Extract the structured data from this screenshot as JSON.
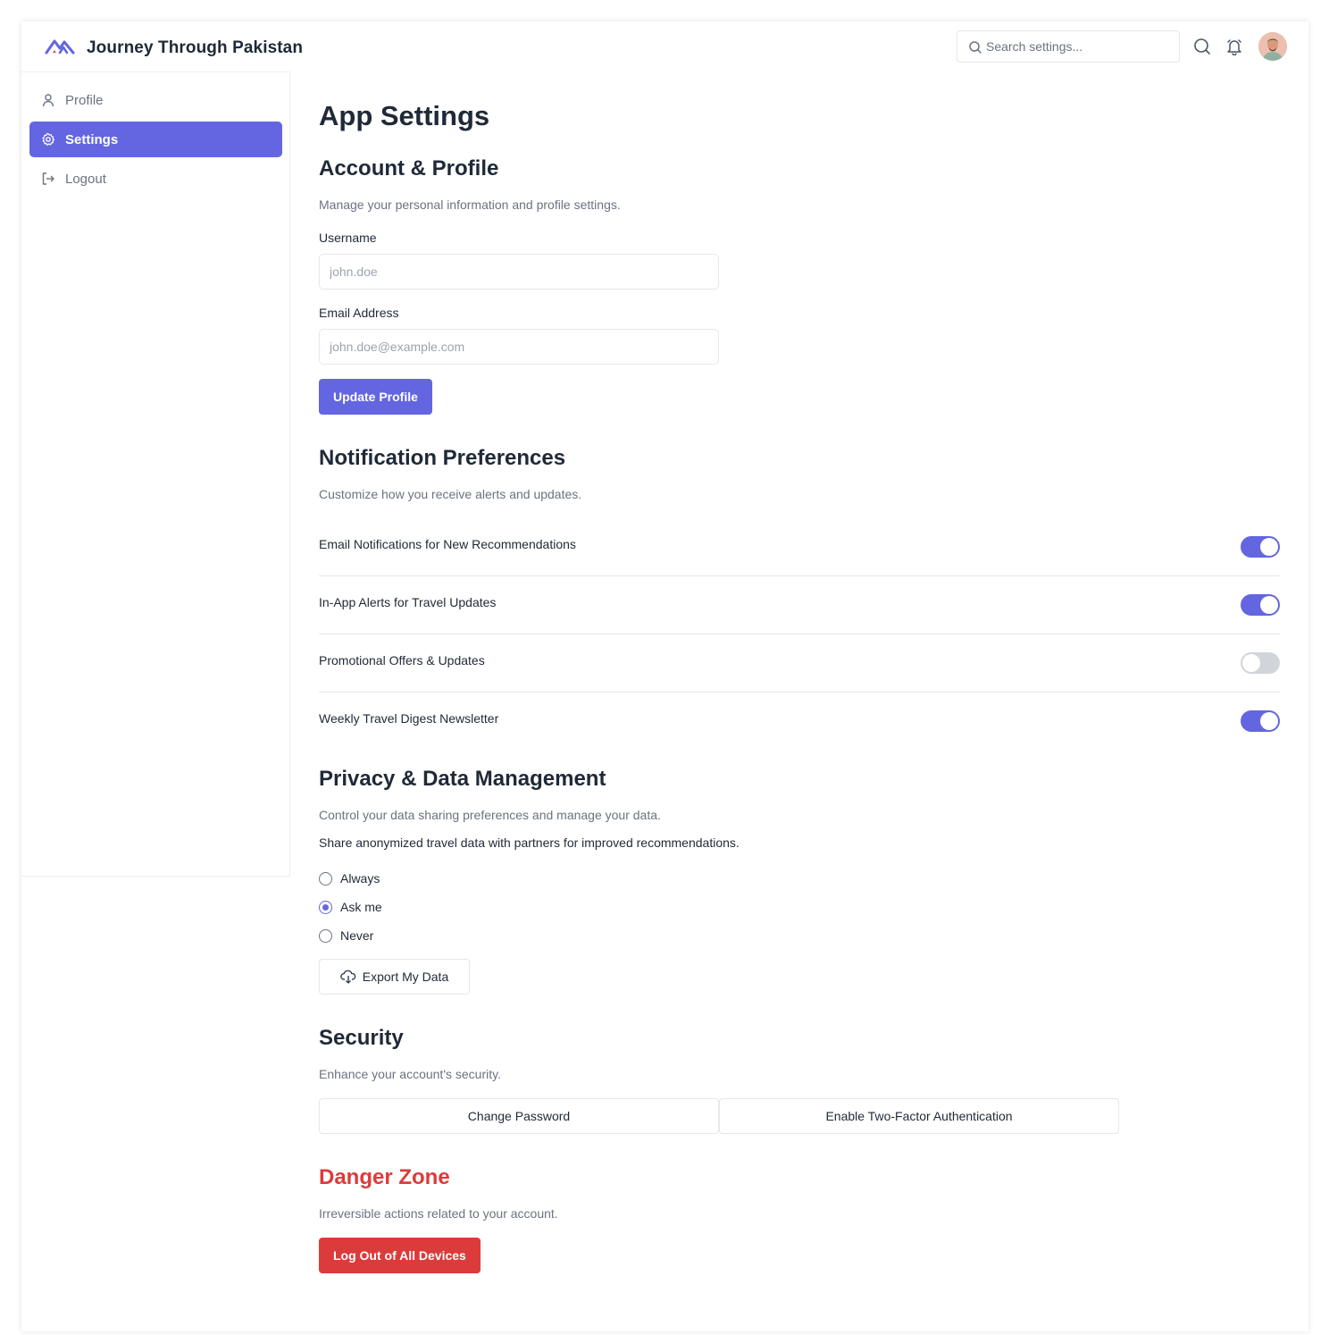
{
  "app": {
    "brand": "Journey Through Pakistan"
  },
  "header": {
    "search_placeholder": "Search settings...",
    "icons": [
      "search-icon",
      "bell-icon",
      "avatar"
    ]
  },
  "sidebar": {
    "items": [
      {
        "label": "Profile",
        "icon": "user-icon",
        "active": false
      },
      {
        "label": "Settings",
        "icon": "gear-icon",
        "active": true
      },
      {
        "label": "Logout",
        "icon": "logout-icon",
        "active": false
      }
    ]
  },
  "main": {
    "title": "App Settings",
    "account": {
      "title": "Account & Profile",
      "description": "Manage your personal information and profile settings.",
      "username_label": "Username",
      "username_placeholder": "john.doe",
      "email_label": "Email Address",
      "email_placeholder": "john.doe@example.com",
      "update_button": "Update Profile"
    },
    "notifications": {
      "title": "Notification Preferences",
      "description": "Customize how you receive alerts and updates.",
      "items": [
        {
          "label": "Email Notifications for New Recommendations",
          "enabled": true
        },
        {
          "label": "In-App Alerts for Travel Updates",
          "enabled": true
        },
        {
          "label": "Promotional Offers & Updates",
          "enabled": false
        },
        {
          "label": "Weekly Travel Digest Newsletter",
          "enabled": true
        }
      ]
    },
    "privacy": {
      "title": "Privacy & Data Management",
      "description": "Control your data sharing preferences and manage your data.",
      "question": "Share anonymized travel data with partners for improved recommendations.",
      "options": [
        {
          "label": "Always",
          "checked": false
        },
        {
          "label": "Ask me",
          "checked": true
        },
        {
          "label": "Never",
          "checked": false
        }
      ],
      "export_button": "Export My Data"
    },
    "security": {
      "title": "Security",
      "description": "Enhance your account's security.",
      "change_password": "Change Password",
      "two_factor": "Enable Two-Factor Authentication"
    },
    "danger": {
      "title": "Danger Zone",
      "description": "Irreversible actions related to your account.",
      "logout_all": "Log Out of All Devices"
    }
  },
  "colors": {
    "accent": "#6366e0",
    "danger": "#dc3b3b",
    "toggle_off": "#d1d5db"
  }
}
